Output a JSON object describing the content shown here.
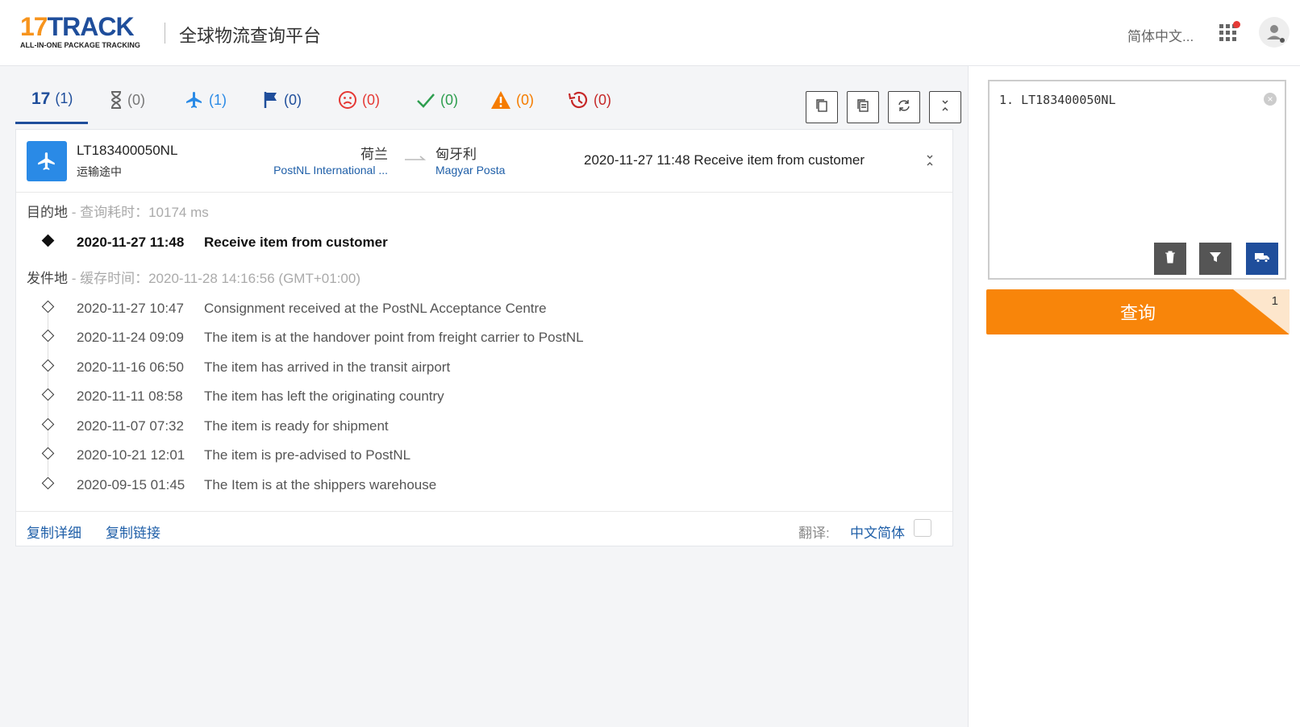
{
  "header": {
    "logo_main": "17TRACK",
    "logo_sub": "ALL-IN-ONE PACKAGE TRACKING",
    "platform_title": "全球物流查询平台",
    "language": "简体中文..."
  },
  "tabs": [
    {
      "icon": "17-logo-icon",
      "count": "(1)",
      "color": "#1f4e9b",
      "active": true
    },
    {
      "icon": "hourglass-icon",
      "count": "(0)",
      "color": "#666666"
    },
    {
      "icon": "airplane-icon",
      "count": "(1)",
      "color": "#2a8ae6"
    },
    {
      "icon": "flag-icon",
      "count": "(0)",
      "color": "#1f4e9b"
    },
    {
      "icon": "sad-face-icon",
      "count": "(0)",
      "color": "#e53935"
    },
    {
      "icon": "check-icon",
      "count": "(0)",
      "color": "#2e9e4f"
    },
    {
      "icon": "warning-icon",
      "count": "(0)",
      "color": "#f57c00"
    },
    {
      "icon": "history-icon",
      "count": "(0)",
      "color": "#c62828"
    }
  ],
  "shipment": {
    "tracking_number": "LT183400050NL",
    "status": "运输途中",
    "origin_country": "荷兰",
    "origin_carrier": "PostNL International ...",
    "dest_country": "匈牙利",
    "dest_carrier": "Magyar Posta",
    "latest_event": "2020-11-27 11:48  Receive item from customer"
  },
  "destination_section": {
    "title": "目的地",
    "subtitle": " - 查询耗时：10174 ms",
    "events": [
      {
        "date": "2020-11-27 11:48",
        "desc": "Receive item from customer"
      }
    ]
  },
  "origin_section": {
    "title": "发件地",
    "subtitle": " - 缓存时间：2020-11-28 14:16:56 (GMT+01:00)",
    "events": [
      {
        "date": "2020-11-27 10:47",
        "desc": "Consignment received at the PostNL Acceptance Centre"
      },
      {
        "date": "2020-11-24 09:09",
        "desc": "The item is at the handover point from freight carrier to PostNL"
      },
      {
        "date": "2020-11-16 06:50",
        "desc": "The item has arrived in the transit airport"
      },
      {
        "date": "2020-11-11 08:58",
        "desc": "The item has left the originating country"
      },
      {
        "date": "2020-11-07 07:32",
        "desc": "The item is ready for shipment"
      },
      {
        "date": "2020-10-21 12:01",
        "desc": "The item is pre-advised to PostNL"
      },
      {
        "date": "2020-09-15 01:45",
        "desc": "The Item is at the shippers warehouse"
      }
    ]
  },
  "footer": {
    "copy_details": "复制详细",
    "copy_link": "复制链接",
    "translate_label": "翻译:",
    "translate_lang": "中文简体"
  },
  "query_panel": {
    "input_text": "1. LT183400050NL",
    "query_button": "查询",
    "count": "1"
  }
}
